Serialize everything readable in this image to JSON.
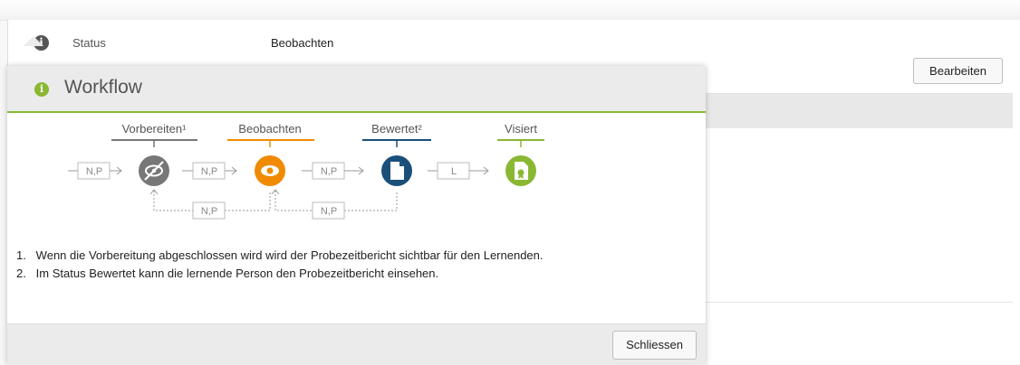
{
  "status": {
    "label": "Status",
    "value": "Beobachten"
  },
  "toolbar": {
    "edit_label": "Bearbeiten"
  },
  "workflow": {
    "title": "Workflow",
    "icon": "info-circle-icon",
    "accent_color": "#8ab833",
    "states": [
      {
        "label": "Vorbereiten¹",
        "color": "#777777",
        "icon": "eye-slash-icon"
      },
      {
        "label": "Beobachten",
        "color": "#f08a00",
        "icon": "eye-icon"
      },
      {
        "label": "Bewertet²",
        "color": "#1a4f7a",
        "icon": "document-icon"
      },
      {
        "label": "Visiert",
        "color": "#8ab833",
        "icon": "certificate-icon"
      }
    ],
    "transitions": {
      "entry": "N,P",
      "t1": "N,P",
      "t2": "N,P",
      "t3": "L",
      "back1": "N,P",
      "back2": "N,P"
    },
    "notes": [
      "1.   Wenn die Vorbereitung abgeschlossen wird wird der Probezeitbericht sichtbar für den Lernenden.",
      "2.   Im Status Bewertet kann die lernende Person den Probezeitbericht einsehen."
    ],
    "close_label": "Schliessen"
  }
}
